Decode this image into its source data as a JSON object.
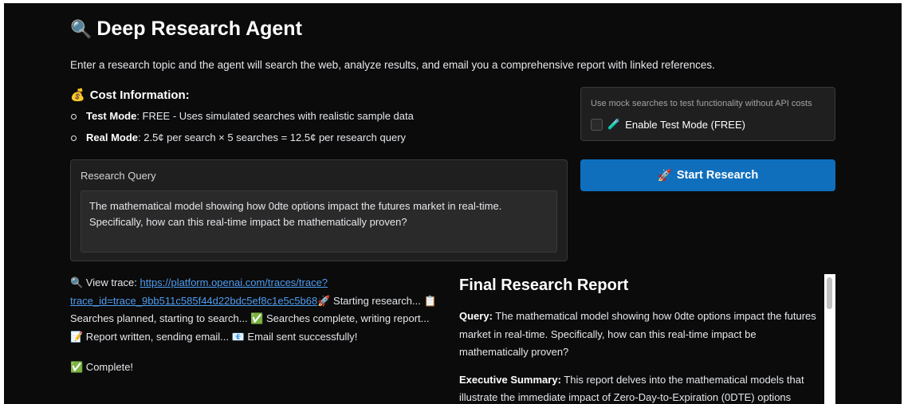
{
  "header": {
    "title": "Deep Research Agent",
    "title_icon": "🔍",
    "intro": "Enter a research topic and the agent will search the web, analyze results, and email you a comprehensive report with linked references."
  },
  "cost": {
    "heading": "Cost Information:",
    "heading_icon": "💰",
    "items": [
      {
        "label": "Test Mode",
        "text": ": FREE - Uses simulated searches with realistic sample data"
      },
      {
        "label": "Real Mode",
        "text": ": 2.5¢ per search × 5 searches = 12.5¢ per research query"
      }
    ]
  },
  "test_mode": {
    "hint": "Use mock searches to test functionality without API costs",
    "icon": "🧪",
    "label": "Enable Test Mode (FREE)"
  },
  "start_button": {
    "icon": "🚀",
    "label": "Start Research"
  },
  "query": {
    "label": "Research Query",
    "value": "The mathematical model showing how 0dte options impact the futures market in real-time. Specifically, how can this real-time impact be mathematically proven?"
  },
  "log": {
    "trace_icon": "🔍",
    "trace_label": " View trace: ",
    "trace_url": "https://platform.openai.com/traces/trace?trace_id=trace_9bb511c585f44d22bdc5ef8c1e5c5b68",
    "step1_icon": "🚀",
    "step1": " Starting research... ",
    "step2_icon": "📋",
    "step2": " Searches planned, starting to search... ",
    "step3_icon": "✅",
    "step3": " Searches complete, writing report... ",
    "step4_icon": "📝",
    "step4": " Report written, sending email... ",
    "step5_icon": "📧",
    "step5": " Email sent successfully!",
    "complete_icon": "✅",
    "complete": " Complete!"
  },
  "report": {
    "title": "Final Research Report",
    "query_label": "Query:",
    "query_text": " The mathematical model showing how 0dte options impact the futures market in real-time. Specifically, how can this real-time impact be mathematically proven?",
    "summary_label": "Executive Summary:",
    "summary_text": " This report delves into the mathematical models that illustrate the immediate impact of Zero-Day-to-Expiration (0DTE) options"
  },
  "colors": {
    "background": "#0b0b0b",
    "panel": "#1f1f1f",
    "accent": "#0f6fbd",
    "link": "#4f9cf0"
  }
}
